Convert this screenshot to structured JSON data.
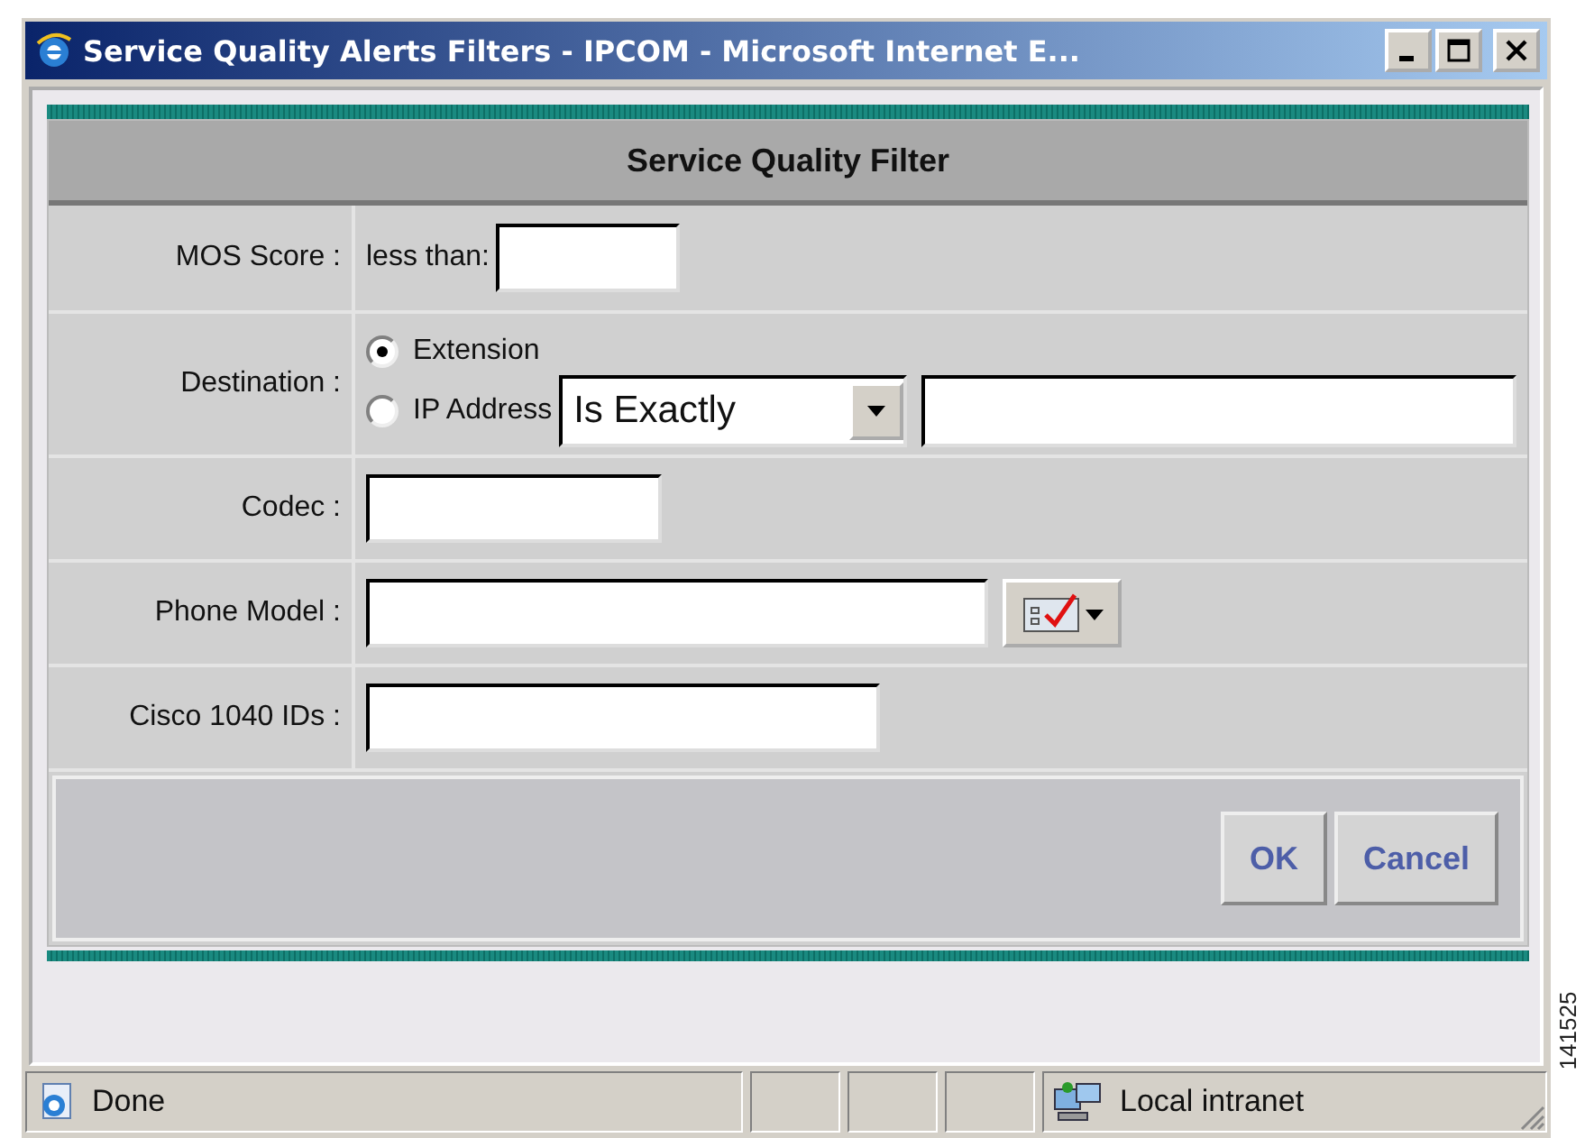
{
  "window": {
    "title": "Service Quality Alerts Filters - IPCOM - Microsoft Internet E..."
  },
  "form": {
    "title": "Service Quality Filter",
    "rows": [
      {
        "kind": "score",
        "label": "MOS Score :",
        "prefix": "less than:"
      },
      {
        "kind": "destination",
        "label": "Destination :",
        "options": [
          {
            "label": "Extension",
            "selected": true
          },
          {
            "label": "IP Address",
            "selected": false
          }
        ],
        "operator": "Is Exactly"
      },
      {
        "kind": "short",
        "label": "Codec :"
      },
      {
        "kind": "picker",
        "label": "Phone Model :"
      },
      {
        "kind": "medium",
        "label": "Cisco 1040 IDs :"
      }
    ]
  },
  "buttons": [
    "OK",
    "Cancel"
  ],
  "status_bar": {
    "text": "Done",
    "zone": "Local intranet"
  },
  "figure_id": "141525"
}
